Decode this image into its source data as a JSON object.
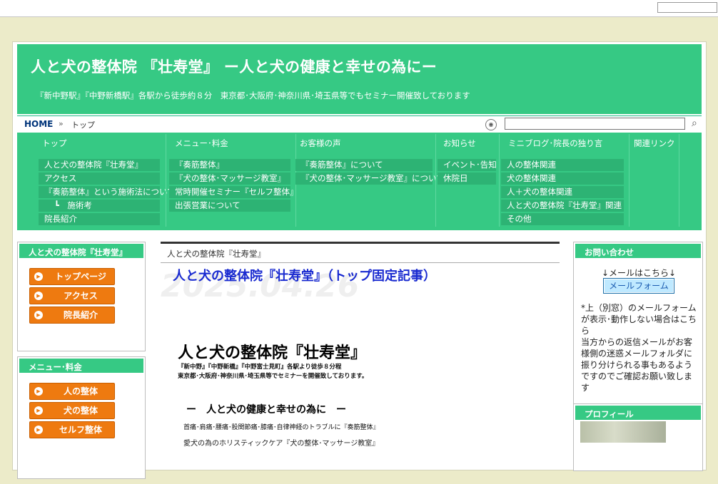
{
  "header": {
    "title": "人と犬の整体院 『壮寿堂』 ー人と犬の健康と幸せの為にー",
    "subtitle": "『新中野駅』『中野新橋駅』各駅から徒歩約８分　東京都･大阪府･神奈川県･埼玉県等でもセミナー開催致しております"
  },
  "breadcrumb": {
    "home": "HOME",
    "separator": "»",
    "current": "トップ"
  },
  "search": {
    "icon": "search-icon",
    "rss_icon": "rss-icon"
  },
  "nav": {
    "columns": [
      {
        "head": "トップ",
        "items": [
          "人と犬の整体院『壮寿堂』",
          "アクセス",
          "『奏筋整体』という施術法について",
          "┗　施術考",
          "院長紹介"
        ]
      },
      {
        "head": "メニュー･料金",
        "items": [
          "『奏筋整体』",
          "『犬の整体･マッサージ教室』",
          "常時開催セミナー『セルフ整体』",
          "出張営業について"
        ]
      },
      {
        "head": "お客様の声",
        "items": [
          "『奏筋整体』について",
          "『犬の整体･マッサージ教室』について"
        ]
      },
      {
        "head": "お知らせ",
        "items": [
          "イベント･告知",
          "休院日"
        ]
      },
      {
        "head": "ミニブログ･院長の独り言",
        "items": [
          "人の整体関連",
          "犬の整体関連",
          "人＋犬の整体関連",
          "人と犬の整体院『壮寿堂』関連",
          "その他"
        ]
      },
      {
        "head": "関連リンク",
        "items": []
      }
    ]
  },
  "left_sidebar": {
    "box1": {
      "head": "人と犬の整体院『壮寿堂』",
      "buttons": [
        "トップページ",
        "アクセス",
        "院長紹介"
      ]
    },
    "box2": {
      "head": "メニュー･料金",
      "buttons": [
        "人の整体",
        "犬の整体",
        "セルフ整体"
      ]
    }
  },
  "main": {
    "category": "人と犬の整体院『壮寿堂』",
    "date": "2025.04.26",
    "post_title": "人と犬の整体院『壮寿堂』（トップ固定記事）",
    "big_title": "人と犬の整体院『壮寿堂』",
    "line1": "『新中野』『中野新橋』『中野富士見町』各駅より徒歩８分程",
    "line2": "東京都･大阪府･神奈川県･埼玉県等でセミナーを開催致しております。",
    "sub_title": "ー　人と犬の健康と幸せの為に　ー",
    "line3": "首痛･肩痛･腰痛･股関節痛･膝痛･自律神経のトラブルに『奏筋整体』",
    "line4": "愛犬の為のホリスティックケア『犬の整体･マッサージ教室』"
  },
  "right_sidebar": {
    "contact": {
      "head": "お問い合わせ",
      "note": "↓メールはこちら↓",
      "button": "メールフォーム",
      "text1": "*上（別窓）のメールフォームが表示･動作しない場合はこちら",
      "text2": "当方からの返信メールがお客様側の迷惑メールフォルダに振り分けられる事もあるようですのでご確認お願い致します"
    },
    "profile": {
      "head": "プロフィール"
    }
  },
  "colors": {
    "accent": "#36c984",
    "button": "#ee7a10",
    "link": "#1a2bd0",
    "page_bg": "#ecebc9"
  }
}
